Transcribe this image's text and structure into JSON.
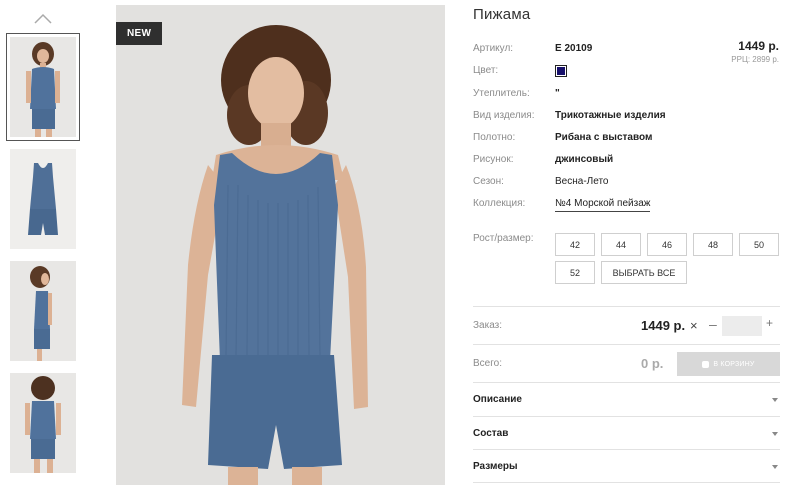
{
  "product": {
    "title": "Пижама",
    "badge": "NEW",
    "price": "1449 р.",
    "rrp": "РРЦ: 2899 р.",
    "color_hex": "#17106b"
  },
  "attributes": [
    {
      "label": "Артикул:",
      "value": "Е 20109",
      "bold": true
    },
    {
      "label": "Цвет:",
      "value": ""
    },
    {
      "label": "Утеплитель:",
      "value": "\"",
      "bold": true
    },
    {
      "label": "Вид изделия:",
      "value": "Трикотажные изделия",
      "bold": true
    },
    {
      "label": "Полотно:",
      "value": "Рибана с выставом",
      "bold": true
    },
    {
      "label": "Рисунок:",
      "value": "джинсовый",
      "bold": true
    },
    {
      "label": "Сезон:",
      "value": "Весна-Лето",
      "bold": false
    },
    {
      "label": "Коллекция:",
      "value": "№4 Морской пейзаж",
      "bold": false
    }
  ],
  "sizes": {
    "label": "Рост/размер:",
    "options": [
      "42",
      "44",
      "46",
      "48",
      "50",
      "52"
    ],
    "select_all": "ВЫБРАТЬ ВСЕ"
  },
  "order": {
    "label": "Заказ:",
    "price": "1449 р.",
    "times": "×",
    "minus": "–",
    "plus": "+",
    "qty": ""
  },
  "total": {
    "label": "Всего:",
    "value": "0 р.",
    "cart_button": "В КОРЗИНУ"
  },
  "accordion": [
    "Описание",
    "Состав",
    "Размеры"
  ],
  "icons": {
    "thumbs_up": "chevron-up-icon",
    "cart": "cart-icon",
    "caret": "chevron-down-icon"
  }
}
